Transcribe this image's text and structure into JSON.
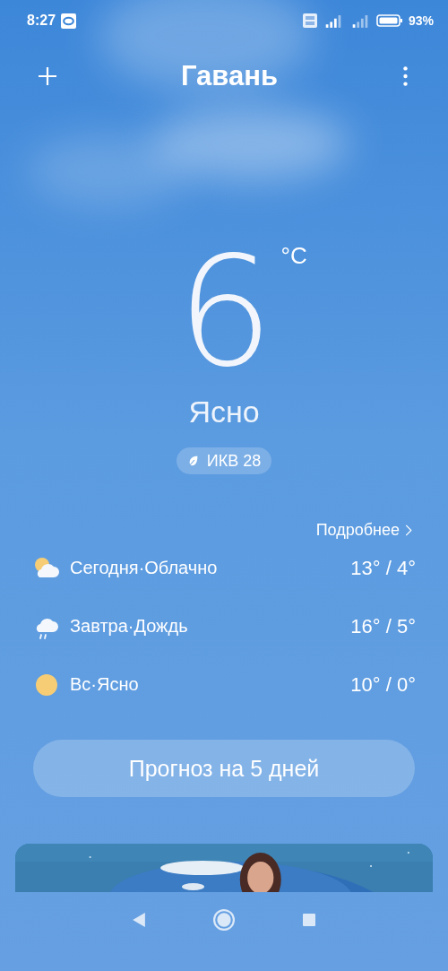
{
  "status_bar": {
    "time": "8:27",
    "battery": "93%"
  },
  "header": {
    "title": "Гавань"
  },
  "current": {
    "temperature": "6",
    "unit": "°C",
    "condition": "Ясно",
    "aqi": "ИКВ 28"
  },
  "forecast": {
    "more_link": "Подробнее",
    "days": [
      {
        "kind": "partly-cloudy",
        "label": "Сегодня·Облачно",
        "temps": "13° / 4°"
      },
      {
        "kind": "rain",
        "label": "Завтра·Дождь",
        "temps": "16° / 5°"
      },
      {
        "kind": "sunny",
        "label": "Вс·Ясно",
        "temps": "10° / 0°"
      }
    ]
  },
  "forecast_button": "Прогноз на 5 дней"
}
